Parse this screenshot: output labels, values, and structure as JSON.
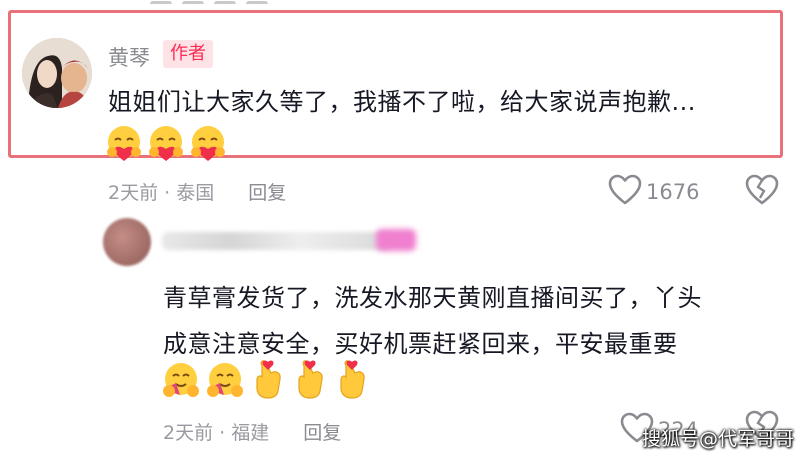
{
  "author_comment": {
    "name": "黄琴",
    "badge": "作者",
    "text": "姐姐们让大家久等了，我播不了啦，给大家说声抱歉...",
    "emojis": [
      "hug-heart-emoji",
      "hug-heart-emoji",
      "hug-heart-emoji"
    ],
    "time": "2天前",
    "location": "泰国",
    "separator": "·",
    "reply_label": "回复",
    "likes": "1676"
  },
  "reply_comment": {
    "lines": [
      "青草膏发货了，洗发水那天黄刚直播间买了，丫头",
      "成意注意安全，买好机票赶紧回来，平安最重要"
    ],
    "emojis": [
      "hugging-face-emoji",
      "hugging-face-emoji",
      "finger-heart-emoji",
      "finger-heart-emoji",
      "finger-heart-emoji"
    ],
    "time": "2天前",
    "location": "福建",
    "separator": "·",
    "reply_label": "回复",
    "likes": "224"
  },
  "watermark": "搜狐号@代军哥哥",
  "colors": {
    "highlight_border": "#e8717a",
    "badge_bg": "#fde3e6",
    "badge_text": "#fe2c55",
    "meta_text": "#9a9ba0"
  }
}
